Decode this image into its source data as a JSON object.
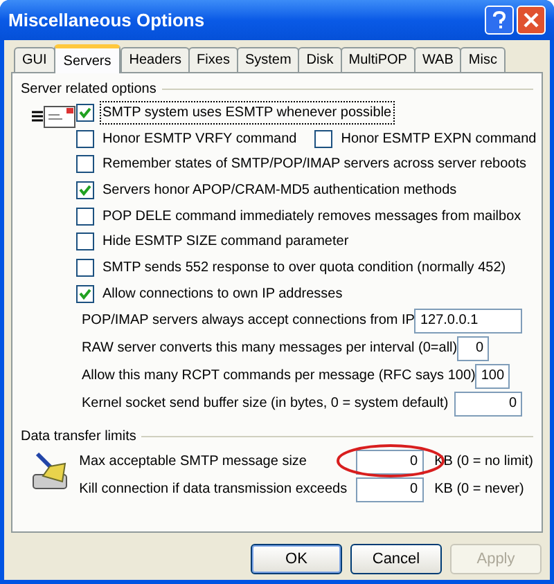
{
  "window": {
    "title": "Miscellaneous Options"
  },
  "tabs": [
    {
      "label": "GUI",
      "selected": false
    },
    {
      "label": "Servers",
      "selected": true
    },
    {
      "label": "Headers",
      "selected": false
    },
    {
      "label": "Fixes",
      "selected": false
    },
    {
      "label": "System",
      "selected": false
    },
    {
      "label": "Disk",
      "selected": false
    },
    {
      "label": "MultiPOP",
      "selected": false
    },
    {
      "label": "WAB",
      "selected": false
    },
    {
      "label": "Misc",
      "selected": false
    }
  ],
  "server_group": {
    "title": "Server related options",
    "option_rows": [
      [
        {
          "label": "SMTP system uses ESMTP whenever possible",
          "checked": true,
          "focused": true
        }
      ],
      [
        {
          "label": "Honor ESMTP VRFY command",
          "checked": false,
          "focused": false
        },
        {
          "label": "Honor ESMTP EXPN command",
          "checked": false,
          "focused": false
        }
      ],
      [
        {
          "label": "Remember states of SMTP/POP/IMAP servers across server reboots",
          "checked": false,
          "focused": false
        }
      ],
      [
        {
          "label": "Servers honor APOP/CRAM-MD5 authentication methods",
          "checked": true,
          "focused": false
        }
      ],
      [
        {
          "label": "POP DELE command immediately removes messages from mailbox",
          "checked": false,
          "focused": false
        }
      ],
      [
        {
          "label": "Hide ESMTP SIZE command parameter",
          "checked": false,
          "focused": false
        }
      ],
      [
        {
          "label": "SMTP sends 552 response to over quota condition (normally 452)",
          "checked": false,
          "focused": false
        }
      ],
      [
        {
          "label": "Allow connections to own IP addresses",
          "checked": true,
          "focused": false
        }
      ]
    ],
    "fields": [
      {
        "label": "POP/IMAP servers always accept connections from IP",
        "value": "127.0.0.1",
        "kind": "text"
      },
      {
        "label": "RAW server converts this many messages per interval (0=all)",
        "value": "0",
        "kind": "short"
      },
      {
        "label": "Allow this many RCPT commands per message (RFC says 100)",
        "value": "100",
        "kind": "short"
      },
      {
        "label": "Kernel socket send buffer size (in bytes, 0 = system default)",
        "value": "0",
        "kind": "long"
      }
    ]
  },
  "data_group": {
    "title": "Data transfer limits",
    "fields": [
      {
        "label": "Max acceptable SMTP message size",
        "value": "0",
        "unit": "KB (0 = no limit)",
        "circled": true
      },
      {
        "label": "Kill connection if data transmission exceeds",
        "value": "0",
        "unit": "KB (0 = never)",
        "circled": false
      }
    ]
  },
  "buttons": [
    {
      "label": "OK",
      "disabled": false
    },
    {
      "label": "Cancel",
      "disabled": false
    },
    {
      "label": "Apply",
      "disabled": true
    }
  ]
}
